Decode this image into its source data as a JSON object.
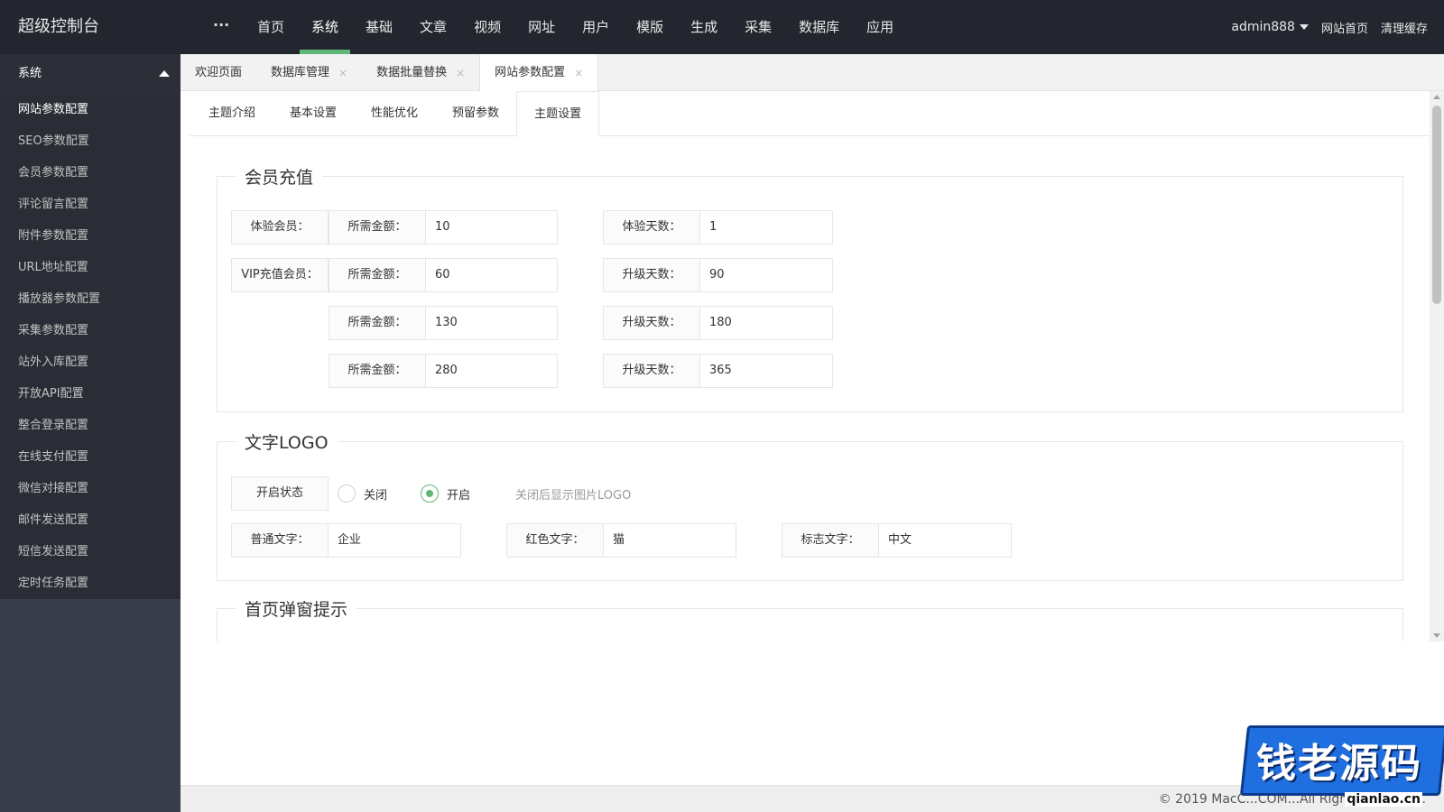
{
  "header": {
    "logo": "超级控制台",
    "more": "···",
    "nav": [
      "首页",
      "系统",
      "基础",
      "文章",
      "视频",
      "网址",
      "用户",
      "模版",
      "生成",
      "采集",
      "数据库",
      "应用"
    ],
    "user": "admin888",
    "links": [
      "网站首页",
      "清理缓存"
    ]
  },
  "sidebar": {
    "title": "系统",
    "items": [
      "网站参数配置",
      "SEO参数配置",
      "会员参数配置",
      "评论留言配置",
      "附件参数配置",
      "URL地址配置",
      "播放器参数配置",
      "采集参数配置",
      "站外入库配置",
      "开放API配置",
      "整合登录配置",
      "在线支付配置",
      "微信对接配置",
      "邮件发送配置",
      "短信发送配置",
      "定时任务配置"
    ]
  },
  "tabs": [
    {
      "label": "欢迎页面",
      "close": ""
    },
    {
      "label": "数据库管理",
      "close": "×"
    },
    {
      "label": "数据批量替换",
      "close": "×"
    },
    {
      "label": "网站参数配置",
      "close": "×"
    }
  ],
  "subtabs": [
    "主题介绍",
    "基本设置",
    "性能优化",
    "预留参数",
    "主题设置"
  ],
  "recharge": {
    "legend": "会员充值",
    "trial_label": "体验会员：",
    "vip_label": "VIP充值会员：",
    "amount_label": "所需金额：",
    "trial_days_label": "体验天数：",
    "upgrade_days_label": "升级天数：",
    "trial_amount": "10",
    "trial_days": "1",
    "rows": [
      {
        "amount": "60",
        "days": "90"
      },
      {
        "amount": "130",
        "days": "180"
      },
      {
        "amount": "280",
        "days": "365"
      }
    ]
  },
  "text_logo": {
    "legend": "文字LOGO",
    "status_label": "开启状态",
    "off": "关闭",
    "on": "开启",
    "hint": "关闭后显示图片LOGO",
    "normal_label": "普通文字：",
    "normal_value": "企业",
    "red_label": "红色文字：",
    "red_value": "猫",
    "mark_label": "标志文字：",
    "mark_value": "中文"
  },
  "popup": {
    "legend": "首页弹窗提示"
  },
  "footer": {
    "copyright": "© 2019 MacC...COM...All Rights Reserved."
  },
  "watermark": {
    "title": "钱老源码",
    "sub": "qianlao.cn"
  },
  "colors": {
    "header_bg": "#23262e",
    "sidebar_bg": "#393d49",
    "accent": "#5fb878"
  }
}
